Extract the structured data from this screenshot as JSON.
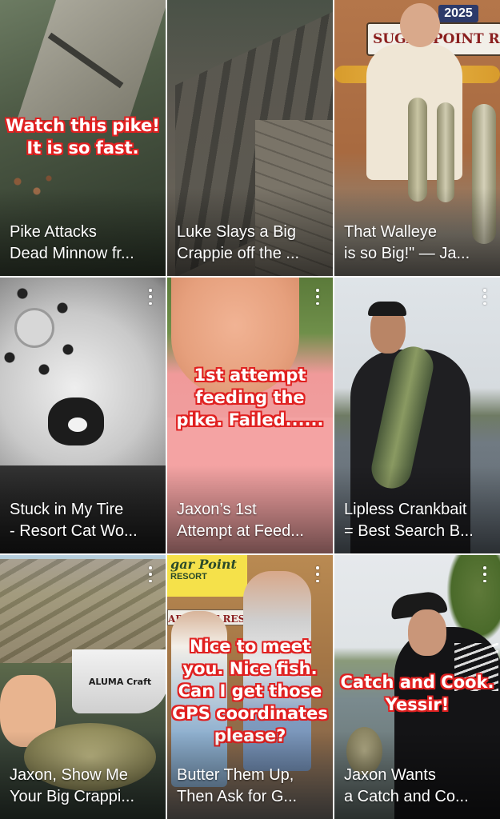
{
  "videos": [
    {
      "title_lines": [
        "Pike Attacks",
        "Dead Minnow fr..."
      ],
      "overlay_lines": [
        "Watch this pike!",
        "It is so fast."
      ],
      "has_menu": false
    },
    {
      "title_lines": [
        "Luke Slays a Big",
        "Crappie off the ..."
      ],
      "overlay_lines": [],
      "has_menu": false
    },
    {
      "title_lines": [
        "That Walleye",
        "is so Big!\" — Ja..."
      ],
      "overlay_lines": [],
      "sign_text": "SUGAR POINT RE",
      "sign_year": "2025",
      "has_menu": false
    },
    {
      "title_lines": [
        "Stuck in My Tire",
        "- Resort Cat Wo..."
      ],
      "overlay_lines": [],
      "has_menu": true
    },
    {
      "title_lines": [
        "Jaxon’s 1st",
        "Attempt at Feed..."
      ],
      "overlay_lines": [
        "1st attempt",
        "feeding the",
        "pike.  Failed......"
      ],
      "has_menu": true
    },
    {
      "title_lines": [
        "Lipless Crankbait",
        "= Best Search B..."
      ],
      "overlay_lines": [],
      "has_menu": true
    },
    {
      "title_lines": [
        "Jaxon, Show Me",
        "Your Big Crappi..."
      ],
      "overlay_lines": [],
      "boat_text": "ALUMA Craft",
      "has_menu": true
    },
    {
      "title_lines": [
        "Butter Them Up,",
        "Then Ask for G..."
      ],
      "overlay_lines": [
        "Nice to meet",
        "you.  Nice fish.",
        "Can I get those",
        "GPS coordinates",
        "please?"
      ],
      "sign_text": "gar Point",
      "sign_sub": "RESORT",
      "sign_text2": "ARPOINT RESOR",
      "has_menu": true
    },
    {
      "title_lines": [
        "Jaxon Wants",
        "a Catch and Co..."
      ],
      "overlay_lines": [
        "Catch and Cook.",
        "Yessir!"
      ],
      "has_menu": true
    }
  ],
  "colors": {
    "caption_stroke": "#e02020",
    "title_text": "#ffffff"
  },
  "icons": {
    "menu": "more-vert-icon"
  }
}
